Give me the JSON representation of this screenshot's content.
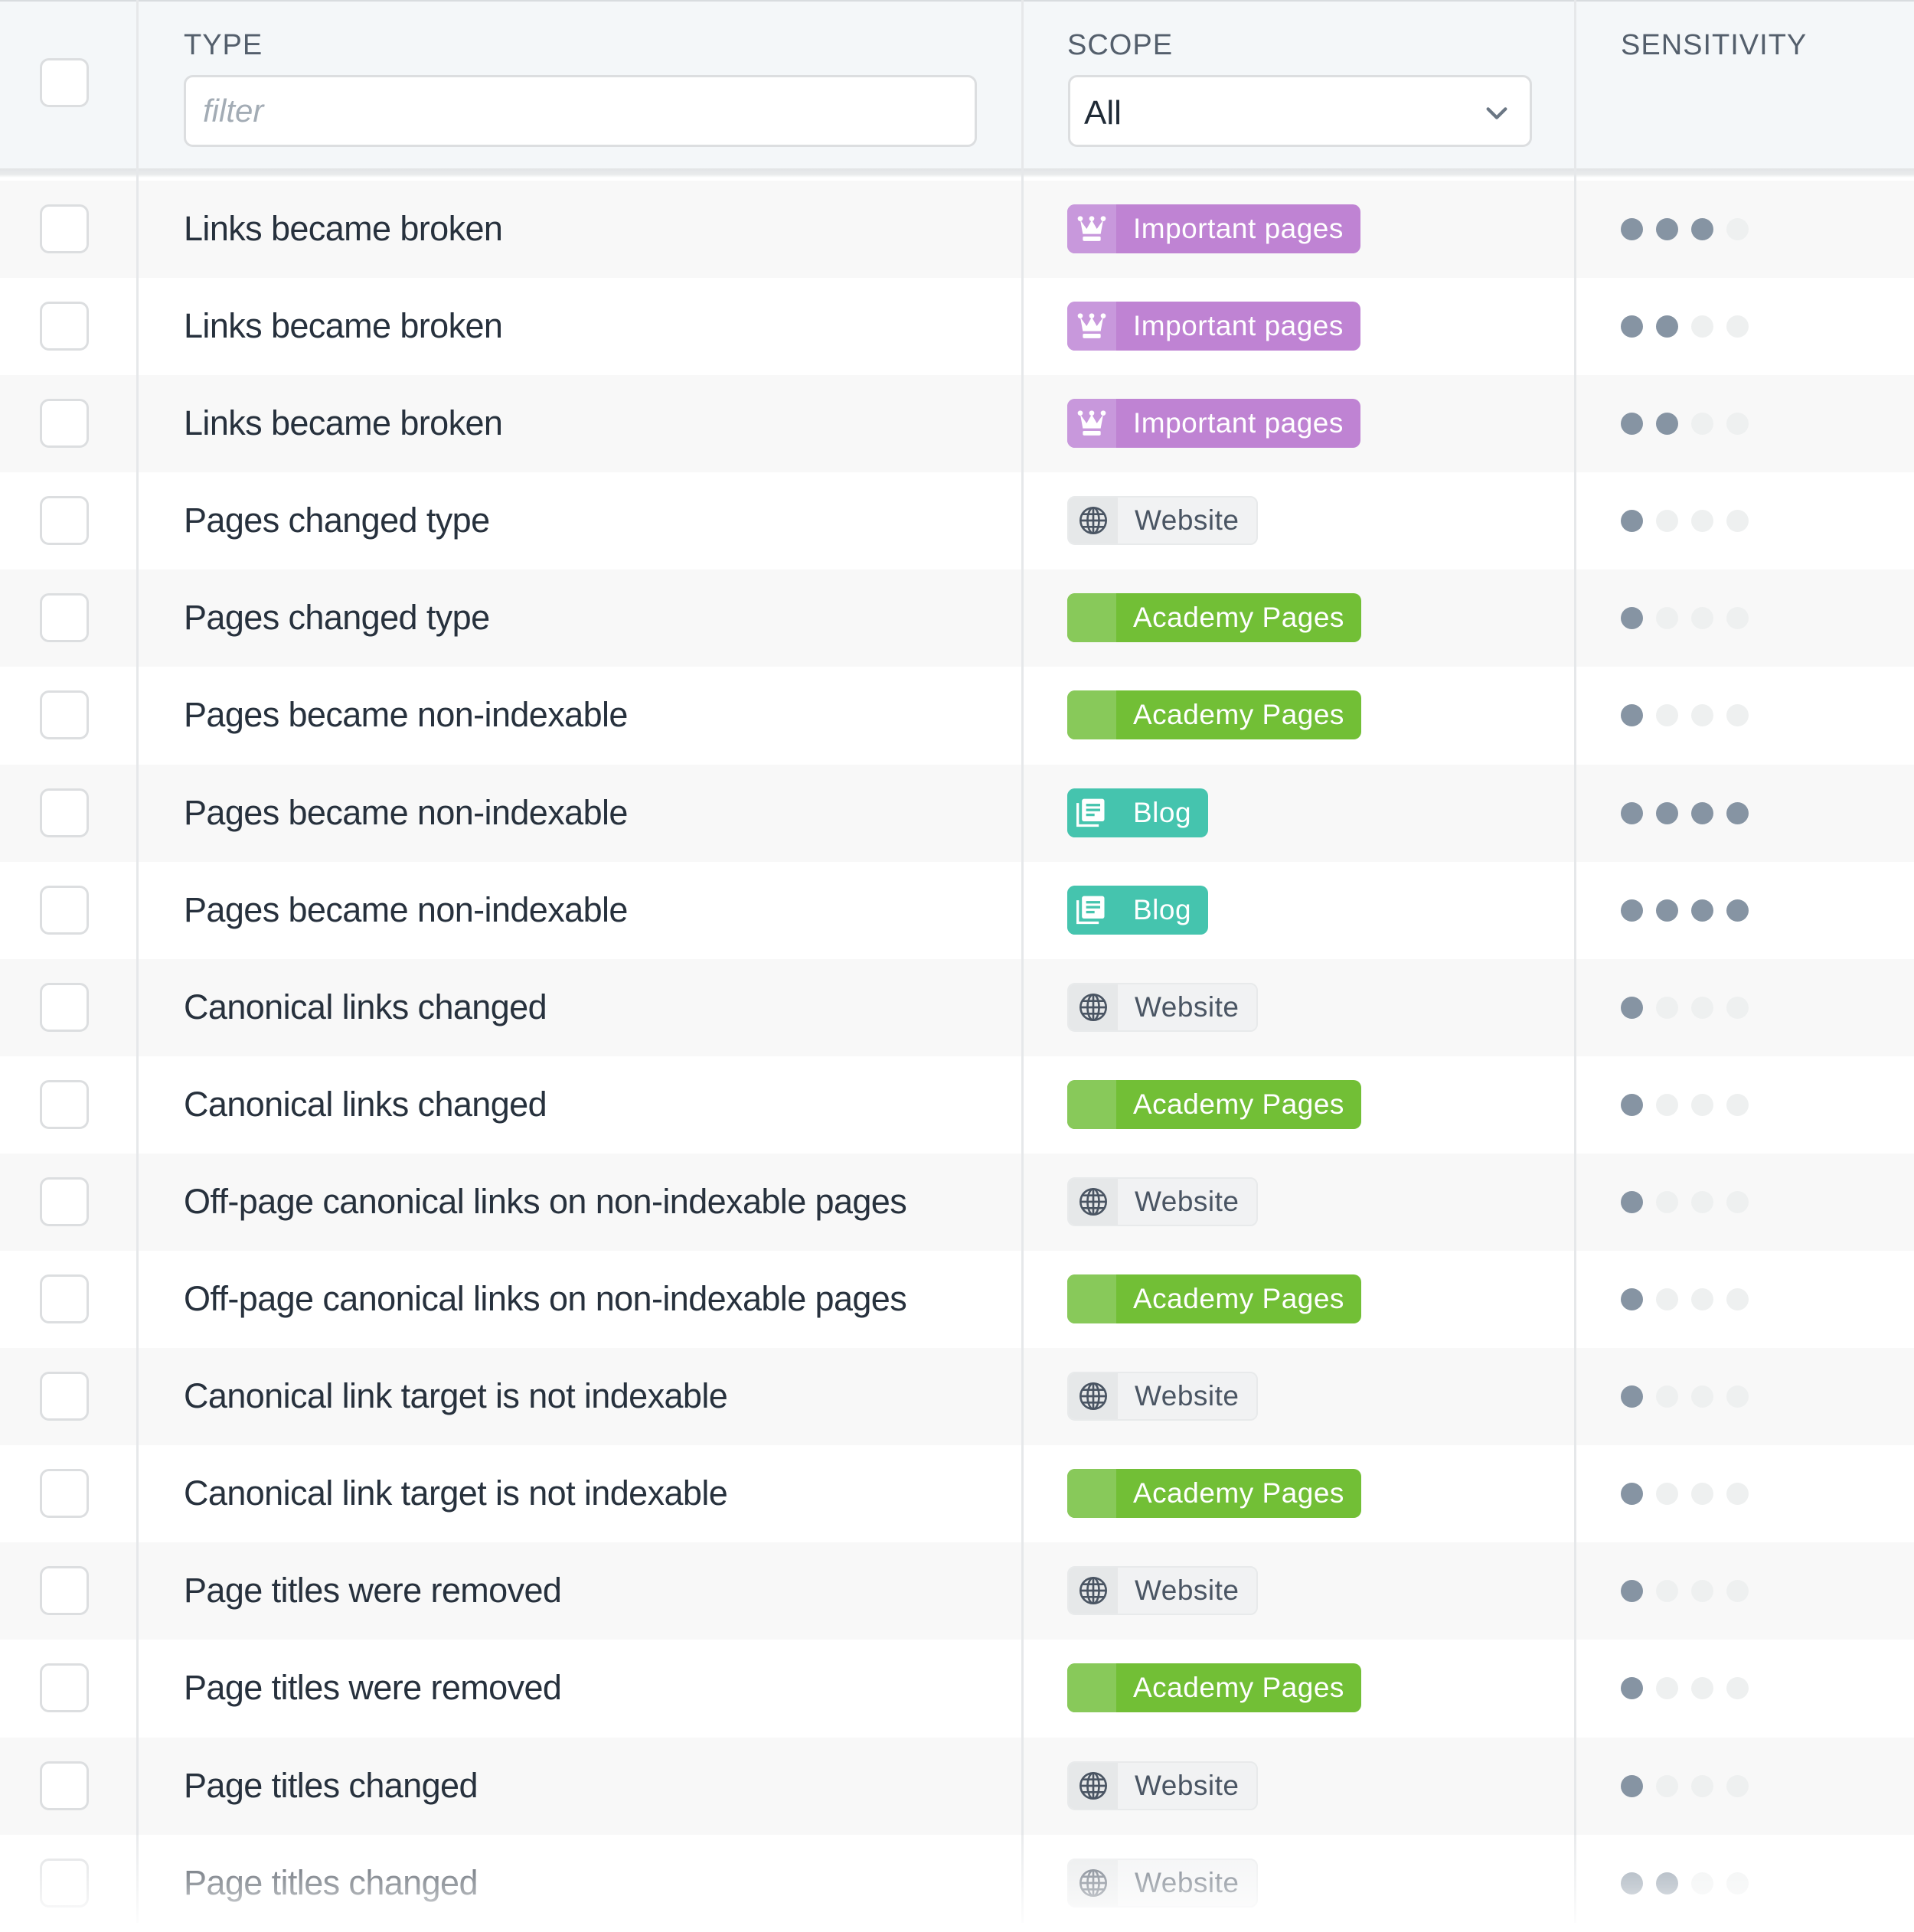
{
  "header": {
    "select_all_checked": false,
    "columns": {
      "type": "TYPE",
      "scope": "SCOPE",
      "sensitivity": "SENSITIVITY"
    },
    "type_filter": {
      "value": "",
      "placeholder": "filter"
    },
    "scope_select": {
      "value": "All"
    }
  },
  "colors": {
    "important": "#bf83d3",
    "academy": "#72bf36",
    "blog": "#45c4ae",
    "website": "#f1f2f3",
    "dot_on": "#8694a3",
    "dot_off": "#eef0f0"
  },
  "sensitivity_max": 4,
  "rows": [
    {
      "type": "Links became broken",
      "scope": "Important pages",
      "scope_kind": "important",
      "scope_icon": "crown-icon",
      "sensitivity": 3
    },
    {
      "type": "Links became broken",
      "scope": "Important pages",
      "scope_kind": "important",
      "scope_icon": "crown-icon",
      "sensitivity": 2
    },
    {
      "type": "Links became broken",
      "scope": "Important pages",
      "scope_kind": "important",
      "scope_icon": "crown-icon",
      "sensitivity": 2
    },
    {
      "type": "Pages changed type",
      "scope": "Website",
      "scope_kind": "website",
      "scope_icon": "globe-icon",
      "sensitivity": 1
    },
    {
      "type": "Pages changed type",
      "scope": "Academy Pages",
      "scope_kind": "academy",
      "scope_icon": "color-swatch-icon",
      "sensitivity": 1
    },
    {
      "type": "Pages became non-indexable",
      "scope": "Academy Pages",
      "scope_kind": "academy",
      "scope_icon": "color-swatch-icon",
      "sensitivity": 1
    },
    {
      "type": "Pages became non-indexable",
      "scope": "Blog",
      "scope_kind": "blog",
      "scope_icon": "articles-icon",
      "sensitivity": 4
    },
    {
      "type": "Pages became non-indexable",
      "scope": "Blog",
      "scope_kind": "blog",
      "scope_icon": "articles-icon",
      "sensitivity": 4
    },
    {
      "type": "Canonical links changed",
      "scope": "Website",
      "scope_kind": "website",
      "scope_icon": "globe-icon",
      "sensitivity": 1
    },
    {
      "type": "Canonical links changed",
      "scope": "Academy Pages",
      "scope_kind": "academy",
      "scope_icon": "color-swatch-icon",
      "sensitivity": 1
    },
    {
      "type": "Off-page canonical links on non-indexable pages",
      "scope": "Website",
      "scope_kind": "website",
      "scope_icon": "globe-icon",
      "sensitivity": 1
    },
    {
      "type": "Off-page canonical links on non-indexable pages",
      "scope": "Academy Pages",
      "scope_kind": "academy",
      "scope_icon": "color-swatch-icon",
      "sensitivity": 1
    },
    {
      "type": "Canonical link target is not indexable",
      "scope": "Website",
      "scope_kind": "website",
      "scope_icon": "globe-icon",
      "sensitivity": 1
    },
    {
      "type": "Canonical link target is not indexable",
      "scope": "Academy Pages",
      "scope_kind": "academy",
      "scope_icon": "color-swatch-icon",
      "sensitivity": 1
    },
    {
      "type": "Page titles were removed",
      "scope": "Website",
      "scope_kind": "website",
      "scope_icon": "globe-icon",
      "sensitivity": 1
    },
    {
      "type": "Page titles were removed",
      "scope": "Academy Pages",
      "scope_kind": "academy",
      "scope_icon": "color-swatch-icon",
      "sensitivity": 1
    },
    {
      "type": "Page titles changed",
      "scope": "Website",
      "scope_kind": "website",
      "scope_icon": "globe-icon",
      "sensitivity": 1
    },
    {
      "type": "Page titles changed",
      "scope": "Website",
      "scope_kind": "website",
      "scope_icon": "globe-icon",
      "sensitivity": 2
    }
  ]
}
